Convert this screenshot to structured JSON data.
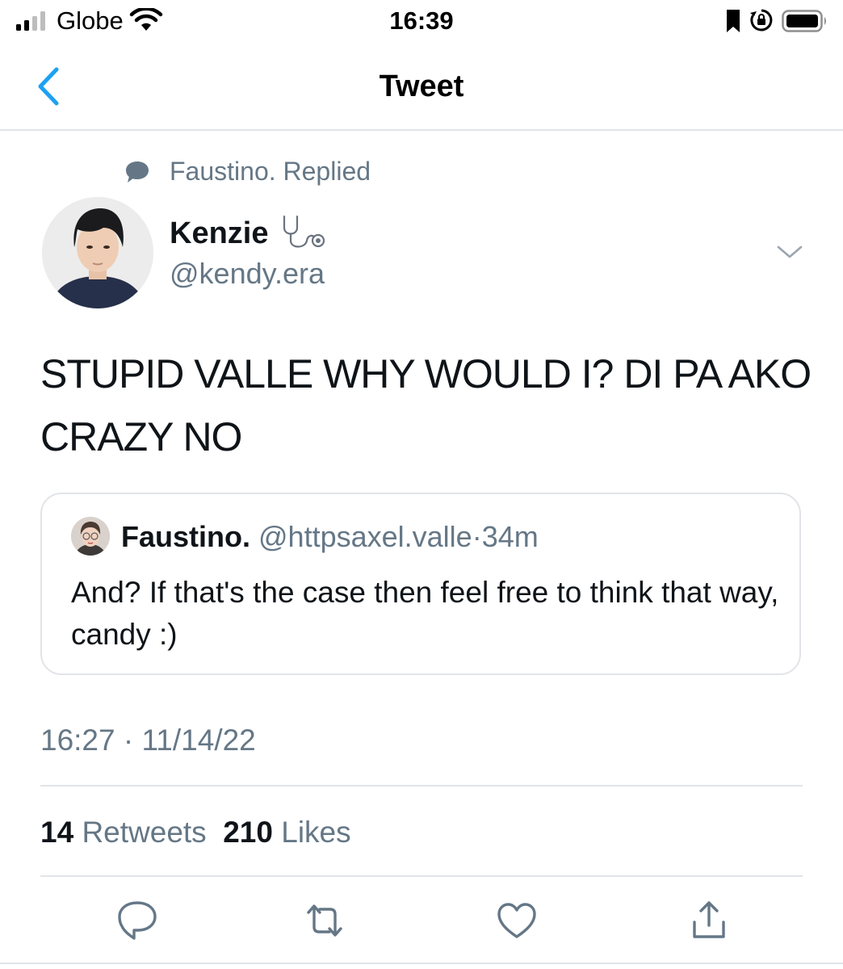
{
  "status_bar": {
    "carrier": "Globe",
    "time": "16:39"
  },
  "nav": {
    "title": "Tweet"
  },
  "social_context": {
    "text": "Faustino. Replied"
  },
  "author": {
    "name": "Kenzie",
    "handle": "@kendy.era",
    "name_emoji_icon": "stethoscope-icon"
  },
  "tweet": {
    "text": "STUPID VALLE WHY WOULD I? DI PA AKO CRAZY NO"
  },
  "quoted_tweet": {
    "name": "Faustino.",
    "handle": "@httpsaxel.valle",
    "separator": "·",
    "time": "34m",
    "text": "And? If that's the case then feel free to think that way, candy :)"
  },
  "timestamp": "16:27 · 11/14/22",
  "stats": {
    "retweets_count": "14",
    "retweets_label": "Retweets",
    "likes_count": "210",
    "likes_label": "Likes"
  },
  "actions": [
    "reply-icon",
    "retweet-icon",
    "like-icon",
    "share-icon"
  ],
  "colors": {
    "accent": "#1da1f2",
    "secondary_text": "#657786",
    "primary_text": "#0f1419",
    "divider": "#e1e4e8"
  }
}
